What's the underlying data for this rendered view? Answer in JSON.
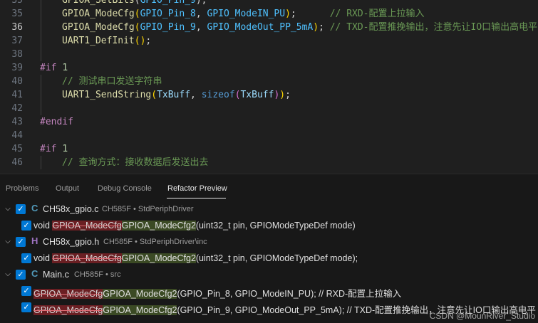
{
  "editor": {
    "lines": [
      {
        "num": "35",
        "segs": [
          [
            "tk-fn",
            "GPIOA_SetBits"
          ],
          [
            "",
            "("
          ],
          [
            "tk-const",
            "GPIO_Pin_9"
          ],
          [
            "",
            "); "
          ]
        ]
      },
      {
        "num": "35",
        "segs": [
          [
            "tk-fn",
            "GPIOA_ModeCfg"
          ],
          [
            "tk-p1",
            "("
          ],
          [
            "tk-const",
            "GPIO_Pin_8"
          ],
          [
            "",
            ", "
          ],
          [
            "tk-const",
            "GPIO_ModeIN_PU"
          ],
          [
            "tk-p1",
            ")"
          ],
          [
            "",
            ";      "
          ],
          [
            "tk-cmt",
            "// RXD-配置上拉输入"
          ]
        ]
      },
      {
        "num": "36",
        "segs": [
          [
            "tk-fn",
            "GPIOA_ModeCfg"
          ],
          [
            "tk-p1",
            "("
          ],
          [
            "tk-const",
            "GPIO_Pin_9"
          ],
          [
            "",
            ", "
          ],
          [
            "tk-const",
            "GPIO_ModeOut_PP_5mA"
          ],
          [
            "tk-p1",
            ")"
          ],
          [
            "",
            "; "
          ],
          [
            "tk-cmt",
            "// TXD-配置推挽输出，注意先让IO口输出高电平"
          ]
        ]
      },
      {
        "num": "37",
        "segs": [
          [
            "tk-fn",
            "UART1_DefInit"
          ],
          [
            "tk-p1",
            "()"
          ],
          [
            "",
            ";"
          ]
        ]
      },
      {
        "num": "38",
        "segs": []
      },
      {
        "num": "39",
        "segs": [
          [
            "tk-pre",
            "#if "
          ],
          [
            "tk-num",
            "1"
          ]
        ]
      },
      {
        "num": "40",
        "segs": [
          [
            "tk-cmt",
            "// 测试串口发送字符串"
          ]
        ]
      },
      {
        "num": "41",
        "segs": [
          [
            "tk-fn",
            "UART1_SendString"
          ],
          [
            "tk-p1",
            "("
          ],
          [
            "tk-var",
            "TxBuff"
          ],
          [
            "",
            ", "
          ],
          [
            "tk-kw",
            "sizeof"
          ],
          [
            "tk-p2",
            "("
          ],
          [
            "tk-var",
            "TxBuff"
          ],
          [
            "tk-p2",
            ")"
          ],
          [
            "tk-p1",
            ")"
          ],
          [
            "",
            ";"
          ]
        ]
      },
      {
        "num": "42",
        "segs": []
      },
      {
        "num": "43",
        "segs": [
          [
            "tk-pre",
            "#endif"
          ]
        ]
      },
      {
        "num": "44",
        "segs": []
      },
      {
        "num": "45",
        "segs": [
          [
            "tk-pre",
            "#if "
          ],
          [
            "tk-num",
            "1"
          ]
        ]
      },
      {
        "num": "46",
        "segs": [
          [
            "tk-cmt",
            "// 查询方式：接收数据后发送出去"
          ]
        ]
      }
    ]
  },
  "panel": {
    "tabs": [
      "Problems",
      "Output",
      "Debug Console",
      "Refactor Preview"
    ],
    "files": [
      {
        "icon": "C",
        "name": "CH58x_gpio.c",
        "desc": "CH585F • StdPeriphDriver"
      },
      {
        "icon": "H",
        "name": "CH58x_gpio.h",
        "desc": "CH585F • StdPeriphDriver\\inc"
      },
      {
        "icon": "C",
        "name": "Main.c",
        "desc": "CH585F • src"
      }
    ],
    "changes": [
      {
        "pre": "void ",
        "del": "GPIOA_ModeCfg",
        "ins": "GPIOA_ModeCfg2",
        "post": "(uint32_t pin, GPIOModeTypeDef mode)"
      },
      {
        "pre": "void ",
        "del": "GPIOA_ModeCfg",
        "ins": "GPIOA_ModeCfg2",
        "post": "(uint32_t pin, GPIOModeTypeDef mode);"
      },
      {
        "pre": "",
        "del": "GPIOA_ModeCfg",
        "ins": "GPIOA_ModeCfg2",
        "post": "(GPIO_Pin_8, GPIO_ModeIN_PU); // RXD-配置上拉输入"
      },
      {
        "pre": "",
        "del": "GPIOA_ModeCfg",
        "ins": "GPIOA_ModeCfg2",
        "post": "(GPIO_Pin_9, GPIO_ModeOut_PP_5mA); // TXD-配置推挽输出，注意先让IO口输出高电平"
      }
    ]
  },
  "watermark": "CSDN @MounRiver_Studio",
  "icons": {
    "expand": "chevron-down-icon",
    "check": "checkbox-icon"
  }
}
